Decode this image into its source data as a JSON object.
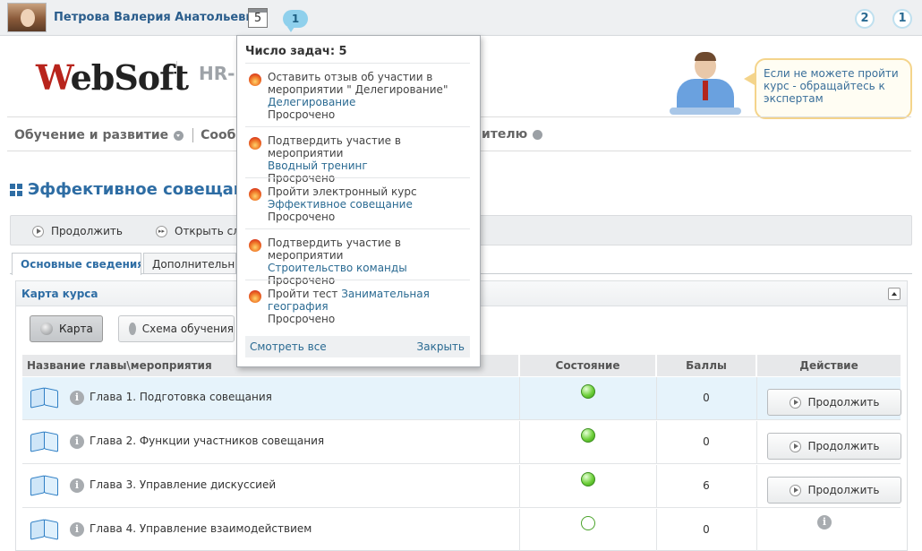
{
  "topbar": {
    "user_name": "Петрова Валерия Анатольевна",
    "calendar_count": "5",
    "messages_count": "1",
    "badge_one": "2",
    "badge_two": "1"
  },
  "header": {
    "logo_text_accent": "W",
    "logo_text_rest": "ebSoft",
    "product_text": "HR-",
    "expert_hint": "Если не можете пройти курс - обращайтесь к экспертам"
  },
  "menu": {
    "items": [
      {
        "label": "Обучение и развитие"
      },
      {
        "label": "Сообще"
      }
    ],
    "right_label": "ителю"
  },
  "page": {
    "title": "Эффективное совещани"
  },
  "toolbar": {
    "continue_label": "Продолжить",
    "open_label": "Открыть сле"
  },
  "tabs": [
    {
      "label": "Основные сведения"
    },
    {
      "label": "Дополнительны"
    }
  ],
  "panel": {
    "title": "Карта курса",
    "map_button": "Карта",
    "scheme_button": "Схема обучения"
  },
  "table": {
    "headers": {
      "name": "Название главы\\мероприятия",
      "state": "Состояние",
      "score": "Баллы",
      "action": "Действие"
    },
    "rows": [
      {
        "name": "Глава 1. Подготовка совещания",
        "score": "0",
        "action": "Продолжить"
      },
      {
        "name": "Глава 2. Функции участников совещания",
        "score": "0",
        "action": "Продолжить"
      },
      {
        "name": "Глава 3. Управление дискуссией",
        "score": "6",
        "action": "Продолжить"
      },
      {
        "name": "Глава 4. Управление взаимодействием",
        "score": "0",
        "action": ""
      }
    ]
  },
  "popup": {
    "heading": "Число задач: 5",
    "tasks": [
      {
        "text": "Оставить отзыв об участии в мероприятии \" Делегирование\"",
        "link": "Делегирование",
        "status": "Просрочено"
      },
      {
        "text": "Подтвердить участие в мероприятии",
        "link": "Вводный тренинг",
        "status": "Просрочено"
      },
      {
        "text": "Пройти электронный курс",
        "link": "Эффективное совещание",
        "status": "Просрочено"
      },
      {
        "text": "Подтвердить участие в мероприятии",
        "link": "Строительство команды",
        "status": "Просрочено"
      },
      {
        "text": "Пройти тест",
        "link": "Занимательная география",
        "status": "Просрочено"
      }
    ],
    "see_all": "Смотреть все",
    "close": "Закрыть"
  }
}
